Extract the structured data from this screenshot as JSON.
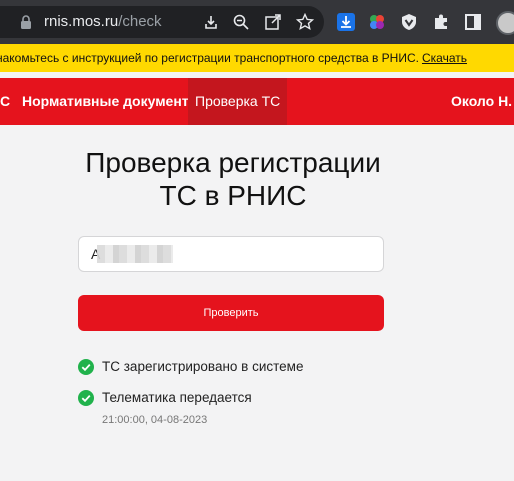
{
  "browser": {
    "url_domain": "rnis.mos.ru",
    "url_path": "/check"
  },
  "notice": {
    "text": "накомьтесь с инструкцией по регистрации транспортного средства в РНИС.",
    "link": "Скачать"
  },
  "nav": {
    "items": [
      {
        "label": "С"
      },
      {
        "label": "Нормативные документы"
      },
      {
        "label": "Проверка ТС"
      },
      {
        "label": "Около Н."
      }
    ]
  },
  "page": {
    "title_line1": "Проверка регистрации",
    "title_line2": "ТС в РНИС"
  },
  "search": {
    "value": "А"
  },
  "check_button": {
    "label": "Проверить"
  },
  "status": {
    "registered": "ТС зарегистрировано в системе",
    "telematics": "Телематика передается",
    "timestamp": "21:00:00, 04-08-2023"
  },
  "colors": {
    "brand_red": "#e5131d",
    "notice_yellow": "#ffd900",
    "success_green": "#21b24c"
  }
}
